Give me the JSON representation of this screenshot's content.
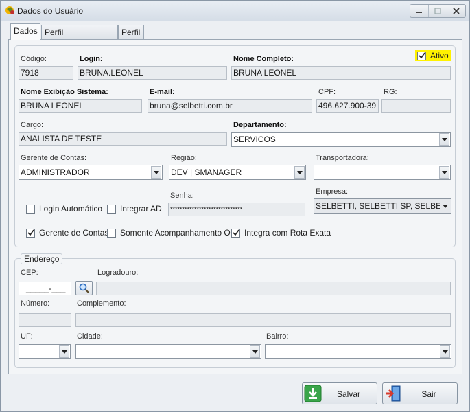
{
  "window": {
    "title": "Dados do Usuário",
    "icon": "app-icon"
  },
  "tabs": [
    {
      "label": "Dados",
      "active": true
    },
    {
      "label": "Perfil Administrativo",
      "active": false
    },
    {
      "label": "Perfil",
      "active": false
    }
  ],
  "user": {
    "codigo_label": "Código:",
    "codigo": "7918",
    "login_label": "Login:",
    "login": "BRUNA.LEONEL",
    "nome_label": "Nome Completo:",
    "nome": "BRUNA LEONEL",
    "ativo_label": "Ativo",
    "ativo": true,
    "exibicao_label": "Nome Exibição Sistema:",
    "exibicao": "BRUNA LEONEL",
    "email_label": "E-mail:",
    "email": "bruna@selbetti.com.br",
    "cpf_label": "CPF:",
    "cpf": "496.627.900-39",
    "rg_label": "RG:",
    "rg": "",
    "cargo_label": "Cargo:",
    "cargo": "ANALISTA DE TESTE",
    "departamento_label": "Departamento:",
    "departamento": "SERVICOS",
    "gerente_label": "Gerente de Contas:",
    "gerente": "ADMINISTRADOR",
    "regiao_label": "Região:",
    "regiao": "DEV | SMANAGER",
    "transportadora_label": "Transportadora:",
    "transportadora": "",
    "senha_label": "Senha:",
    "senha": "******************************",
    "empresa_label": "Empresa:",
    "empresa": "SELBETTI, SELBETTI SP, SELBE...",
    "login_automatico_label": "Login Automático",
    "login_automatico": false,
    "integrar_ad_label": "Integrar AD",
    "integrar_ad": false,
    "gerente_contas_chk_label": "Gerente de Contas",
    "gerente_contas_chk": true,
    "somente_os_label": "Somente Acompanhamento OS",
    "somente_os": false,
    "integra_rota_label": "Integra com Rota Exata",
    "integra_rota": true
  },
  "endereco": {
    "legend": "Endereço",
    "cep_label": "CEP:",
    "cep": "_____-___",
    "logradouro_label": "Logradouro:",
    "logradouro": "",
    "numero_label": "Número:",
    "numero": "",
    "complemento_label": "Complemento:",
    "complemento": "",
    "uf_label": "UF:",
    "uf": "",
    "cidade_label": "Cidade:",
    "cidade": "",
    "bairro_label": "Bairro:",
    "bairro": ""
  },
  "buttons": {
    "salvar": "Salvar",
    "sair": "Sair"
  },
  "colors": {
    "highlight": "#fff200",
    "save_green": "#3aa54a",
    "exit_red": "#d83b2d",
    "exit_blue": "#2f6fc1"
  }
}
